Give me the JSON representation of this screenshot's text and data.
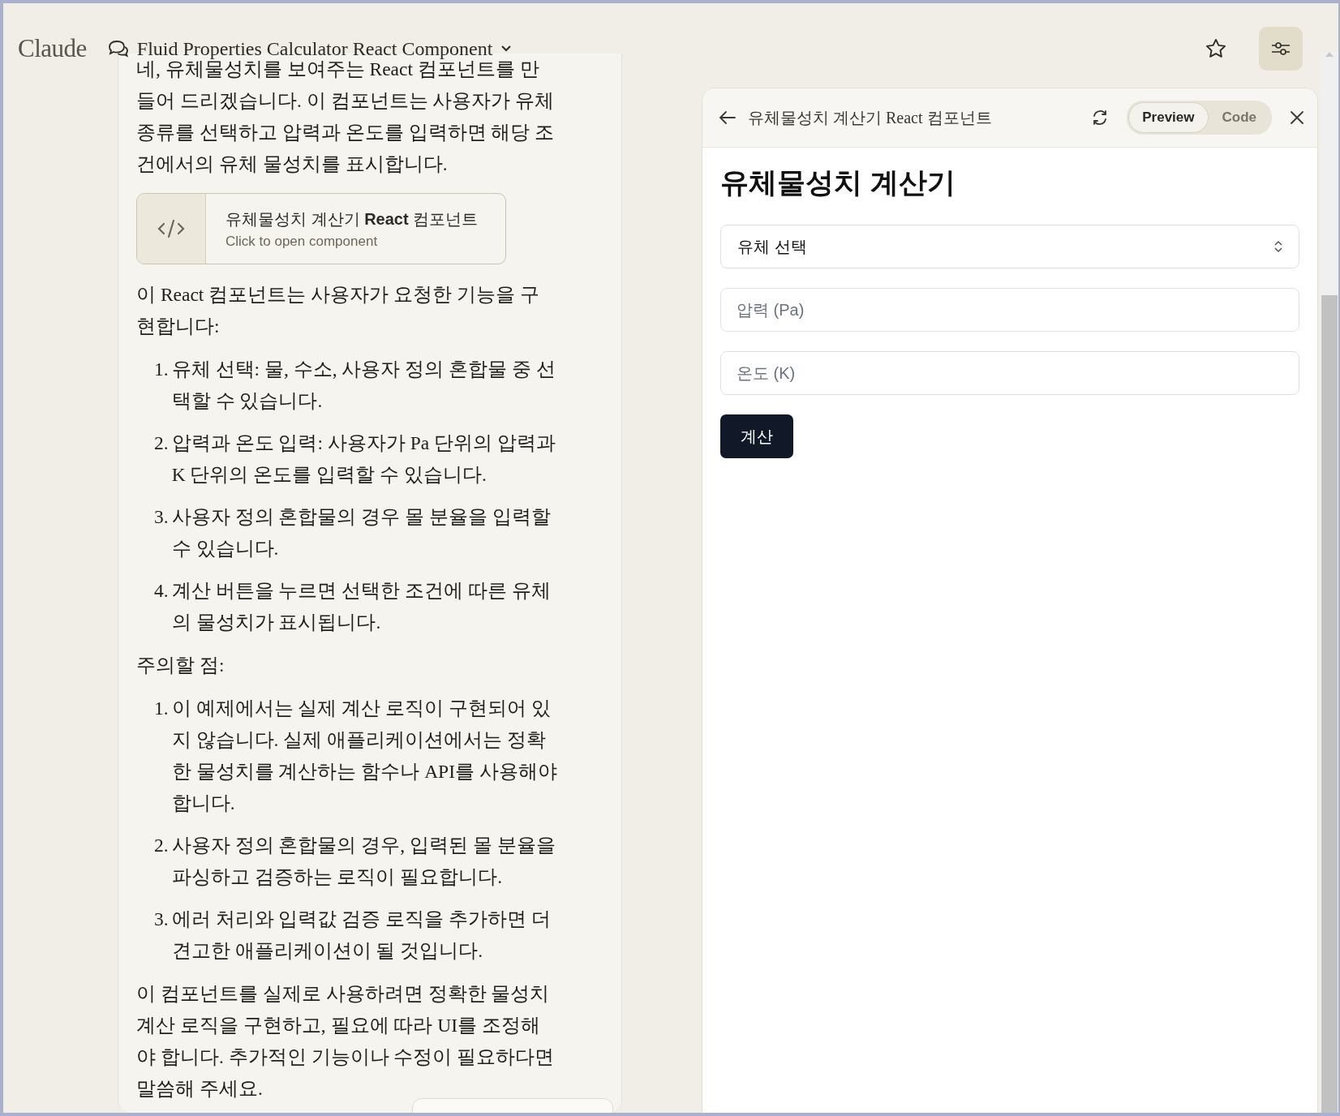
{
  "app": {
    "logo": "Claude",
    "chat_title": "Fluid Properties Calculator React Component"
  },
  "chat": {
    "blocks": [
      {
        "kind": "paragraph",
        "text": "네, 유체물성치를 보여주는 React 컴포넌트를 만들어 드리겠습니다. 이 컴포넌트는 사용자가 유체 종류를 선택하고 압력과 온도를 입력하면 해당 조건에서의 유체 물성치를 표시합니다."
      },
      {
        "kind": "artifact",
        "title": "유체물성치 계산기 **React** 컴포넌트",
        "subtitle": "Click to open component"
      },
      {
        "kind": "paragraph",
        "text": "이 React 컴포넌트는 사용자가 요청한 기능을 구현합니다:"
      },
      {
        "kind": "list",
        "items": [
          {
            "number": "1.",
            "text": "유체 선택: 물, 수소, 사용자 정의 혼합물 중 선택할 수 있습니다."
          },
          {
            "number": "2.",
            "text": "압력과 온도 입력: 사용자가 Pa 단위의 압력과 K 단위의 온도를 입력할 수 있습니다."
          },
          {
            "number": "3.",
            "text": "사용자 정의 혼합물의 경우 몰 분율을 입력할 수 있습니다."
          },
          {
            "number": "4.",
            "text": "계산 버튼을 누르면 선택한 조건에 따른 유체의 물성치가 표시됩니다."
          }
        ]
      },
      {
        "kind": "paragraph",
        "text": "주의할 점:"
      },
      {
        "kind": "list",
        "items": [
          {
            "number": "1.",
            "text": "이 예제에서는 실제 계산 로직이 구현되어 있지 않습니다. 실제 애플리케이션에서는 정확한 물성치를 계산하는 함수나 API를 사용해야 합니다."
          },
          {
            "number": "2.",
            "text": "사용자 정의 혼합물의 경우, 입력된 몰 분율을 파싱하고 검증하는 로직이 필요합니다."
          },
          {
            "number": "3.",
            "text": "에러 처리와 입력값 검증 로직을 추가하면 더 견고한 애플리케이션이 될 것입니다."
          }
        ]
      },
      {
        "kind": "paragraph",
        "text": "이 컴포넌트를 실제로 사용하려면 정확한 물성치 계산 로직을 구현하고, 필요에 따라 UI를 조정해야 합니다. 추가적인 기능이나 수정이 필요하다면 말씀해 주세요."
      }
    ]
  },
  "artifact_panel": {
    "title": "유체물성치 계산기 React 컴포넌트",
    "tabs": [
      {
        "label": "Preview",
        "selected": true
      },
      {
        "label": "Code",
        "selected": false
      }
    ],
    "heading": "유체물성치 계산기",
    "fields": [
      {
        "kind": "select",
        "value": "유체 선택"
      },
      {
        "kind": "input",
        "placeholder": "압력 (Pa)"
      },
      {
        "kind": "input",
        "placeholder": "온도 (K)"
      }
    ],
    "button": "계산"
  }
}
